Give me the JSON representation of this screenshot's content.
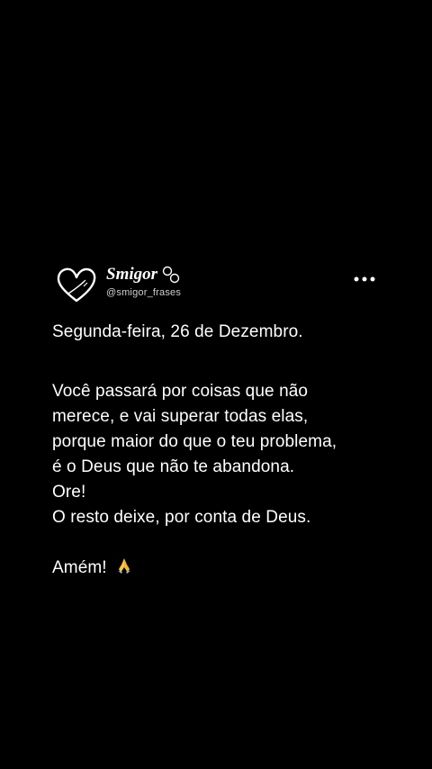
{
  "post": {
    "author": {
      "display_name": "Smigor",
      "handle": "@smigor_frases",
      "avatar_icon": "heart-logo-icon",
      "badge_icon": "rings-icon"
    },
    "more_icon": "more-horizontal-icon",
    "date_line": "Segunda-feira, 26 de Dezembro.",
    "message_lines": [
      "Você passará por coisas que não",
      "merece, e vai superar todas elas,",
      "porque maior do que o teu problema,",
      "é o Deus que não te abandona.",
      "Ore!",
      "O resto deixe, por conta de Deus."
    ],
    "closing": "Amém!",
    "closing_emoji": "praying-hands-icon"
  },
  "colors": {
    "background": "#000000",
    "text": "#ffffff",
    "handle": "#cfcfcf"
  }
}
